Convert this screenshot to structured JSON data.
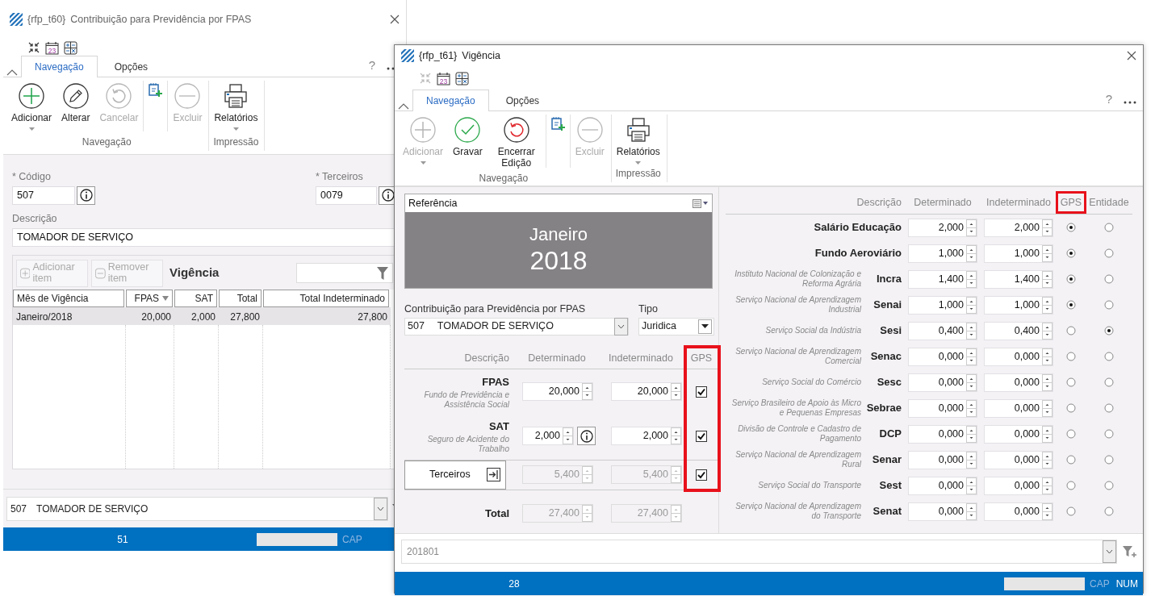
{
  "main_window": {
    "title_code": "{rfp_t60}",
    "title": "Contribuição para Previdência por FPAS",
    "quick_tools": [
      {
        "kind": "collapse",
        "disabled": false
      },
      {
        "kind": "calendar",
        "text": "23",
        "disabled": false
      },
      {
        "kind": "calculator",
        "disabled": false
      }
    ],
    "tabs": [
      {
        "label": "Navegação",
        "selected": true
      },
      {
        "label": "Opções",
        "selected": false
      }
    ],
    "help": "?",
    "ribbon_groups": [
      {
        "label": "Navegação",
        "buttons": [
          {
            "kind": "add",
            "label": "Adicionar",
            "disabled": false,
            "dropdown": true
          },
          {
            "kind": "edit",
            "label": "Alterar",
            "disabled": false,
            "dropdown": false
          },
          {
            "kind": "undo",
            "label": "Cancelar",
            "disabled": true,
            "dropdown": false
          },
          {
            "kind": "clipboard"
          },
          {
            "kind": "delete",
            "label": "Excluir",
            "disabled": true,
            "dropdown": false
          }
        ]
      },
      {
        "label": "Impressão",
        "buttons": [
          {
            "kind": "print",
            "label": "Relatórios",
            "disabled": false,
            "dropdown": true
          }
        ]
      }
    ],
    "codigo": {
      "label": "* Código",
      "value": "507"
    },
    "terceiros": {
      "label": "* Terceiros",
      "value": "0079"
    },
    "descricao": {
      "label": "Descrição",
      "value": "TOMADOR DE SERVIÇO"
    },
    "grid": {
      "buttons": [
        {
          "kind": "add",
          "label": "Adicionar item",
          "disabled": true
        },
        {
          "kind": "remove",
          "label": "Remover item",
          "disabled": true
        }
      ],
      "title": "Vigência",
      "columns": [
        {
          "label": "Mês de Vigência",
          "sorted": false
        },
        {
          "label": "FPAS",
          "sorted": true
        },
        {
          "label": "SAT",
          "sorted": false
        },
        {
          "label": "Total",
          "sorted": false
        },
        {
          "label": "Total Indeterminado",
          "sorted": false
        }
      ],
      "rows": [
        {
          "selected": true,
          "cells": [
            "Janeiro/2018",
            "20,000",
            "2,000",
            "27,800",
            "27,800"
          ]
        }
      ]
    },
    "bottom_combo": {
      "code": "507",
      "text": "TOMADOR DE SERVIÇO"
    },
    "status_bar": {
      "count": "51",
      "indicators": [
        {
          "label": "CAP",
          "on": false
        }
      ]
    }
  },
  "dialog": {
    "title_code": "{rfp_t61}",
    "title": "Vigência",
    "quick_tools": [
      {
        "kind": "collapse",
        "disabled": true
      },
      {
        "kind": "calendar",
        "text": "23",
        "disabled": false
      },
      {
        "kind": "calculator",
        "disabled": false
      }
    ],
    "tabs": [
      {
        "label": "Navegação",
        "selected": true
      },
      {
        "label": "Opções",
        "selected": false
      }
    ],
    "help": "?",
    "ribbon_groups": [
      {
        "label": "Navegação",
        "buttons": [
          {
            "kind": "add",
            "label": "Adicionar",
            "disabled": true,
            "dropdown": true
          },
          {
            "kind": "save",
            "label": "Gravar",
            "disabled": false,
            "dropdown": false
          },
          {
            "kind": "undo",
            "label": "Encerrar Edição",
            "disabled": false,
            "dropdown": false
          },
          {
            "kind": "clipboard"
          },
          {
            "kind": "delete",
            "label": "Excluir",
            "disabled": true,
            "dropdown": false
          }
        ]
      },
      {
        "label": "Impressão",
        "buttons": [
          {
            "kind": "print",
            "label": "Relatórios",
            "disabled": false,
            "dropdown": true
          }
        ]
      }
    ],
    "referencia": {
      "label": "Referência",
      "month": "Janeiro",
      "year": "2018"
    },
    "contribuicao": {
      "label": "Contribuição para Previdência por FPAS",
      "code": "507",
      "text": "TOMADOR DE SERVIÇO"
    },
    "tipo": {
      "label": "Tipo",
      "value": "Juridica"
    },
    "aliquotas": {
      "columns": [
        {
          "label": "Descrição",
          "highlighted": false
        },
        {
          "label": "Determinado",
          "highlighted": false
        },
        {
          "label": "Indeterminado",
          "highlighted": false
        },
        {
          "label": "GPS",
          "highlighted": true
        }
      ],
      "rows": [
        {
          "kind": "main",
          "name": "FPAS",
          "description": "Fundo de Previdência e Assistência Social",
          "determinado": "20,000",
          "indeterminado": "20,000",
          "gps": true,
          "info": false
        },
        {
          "kind": "main",
          "name": "SAT",
          "description": "Seguro de Acidente do Trabalho",
          "determinado": "2,000",
          "indeterminado": "2,000",
          "gps": true,
          "info": true
        },
        {
          "kind": "link",
          "button": "Terceiros",
          "determinado": "5,400",
          "indeterminado": "5,400",
          "gps": true
        },
        {
          "kind": "total",
          "name": "Total",
          "determinado": "27,400",
          "indeterminado": "27,400"
        }
      ]
    },
    "terceiros": {
      "columns": [
        {
          "label": "Descrição",
          "highlighted": false
        },
        {
          "label": "Determinado",
          "highlighted": false
        },
        {
          "label": "Indeterminado",
          "highlighted": false
        },
        {
          "label": "GPS",
          "highlighted": true
        },
        {
          "label": "Entidade",
          "highlighted": false
        }
      ],
      "rows": [
        {
          "name": "Salário Educação",
          "determinado": "2,000",
          "indeterminado": "2,000",
          "gps": true,
          "entidade": false
        },
        {
          "name": "Fundo Aeroviário",
          "determinado": "1,000",
          "indeterminado": "1,000",
          "gps": true,
          "entidade": false
        },
        {
          "name": "Incra",
          "description": "Instituto Nacional de Colonização e Reforma Agrária",
          "determinado": "1,400",
          "indeterminado": "1,400",
          "gps": true,
          "entidade": false
        },
        {
          "name": "Senai",
          "description": "Serviço Nacional de Aprendizagem Industrial",
          "determinado": "1,000",
          "indeterminado": "1,000",
          "gps": true,
          "entidade": false
        },
        {
          "name": "Sesi",
          "description": "Serviço Social da Indústria",
          "determinado": "0,400",
          "indeterminado": "0,400",
          "gps": false,
          "entidade": true
        },
        {
          "name": "Senac",
          "description": "Serviço Nacional de Aprendizagem Comercial",
          "determinado": "0,000",
          "indeterminado": "0,000",
          "gps": false,
          "entidade": false
        },
        {
          "name": "Sesc",
          "description": "Serviço Social do Comércio",
          "determinado": "0,000",
          "indeterminado": "0,000",
          "gps": false,
          "entidade": false
        },
        {
          "name": "Sebrae",
          "description": "Serviço Brasileiro de Apoio às Micro e Pequenas Empresas",
          "determinado": "0,000",
          "indeterminado": "0,000",
          "gps": false,
          "entidade": false
        },
        {
          "name": "DCP",
          "description": "Divisão de Controle e Cadastro de Pagamento",
          "determinado": "0,000",
          "indeterminado": "0,000",
          "gps": false,
          "entidade": false
        },
        {
          "name": "Senar",
          "description": "Serviço Nacional de Aprendizagem Rural",
          "determinado": "0,000",
          "indeterminado": "0,000",
          "gps": false,
          "entidade": false
        },
        {
          "name": "Sest",
          "description": "Serviço Social do Transporte",
          "determinado": "0,000",
          "indeterminado": "0,000",
          "gps": false,
          "entidade": false
        },
        {
          "name": "Senat",
          "description": "Serviço Nacional de Aprendizagem do Transporte",
          "determinado": "0,000",
          "indeterminado": "0,000",
          "gps": false,
          "entidade": false
        }
      ]
    },
    "bottom_field": {
      "value": "201801"
    },
    "status_bar": {
      "count": "28",
      "indicators": [
        {
          "label": "CAP",
          "on": false
        },
        {
          "label": "NUM",
          "on": true
        }
      ]
    }
  }
}
